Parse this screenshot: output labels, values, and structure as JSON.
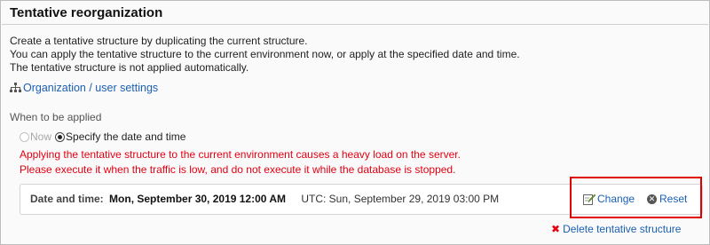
{
  "page": {
    "title": "Tentative reorganization"
  },
  "description": {
    "line1": "Create a tentative structure by duplicating the current structure.",
    "line2": "You can apply the tentative structure to the current environment now, or apply at the specified date and time.",
    "line3": "The tentative structure is not applied automatically."
  },
  "org_link": {
    "label": "Organization / user settings",
    "icon": "org-chart-icon"
  },
  "apply_section": {
    "label": "When to be applied",
    "options": [
      {
        "label": "Now",
        "selected": false,
        "enabled": false
      },
      {
        "label": "Specify the date and time",
        "selected": true,
        "enabled": true
      }
    ]
  },
  "warning": {
    "line1": "Applying the tentative structure to the current environment causes a heavy load on the server.",
    "line2": "Please execute it when the traffic is low, and do not execute it while the database is stopped.",
    "color": "#e60012"
  },
  "schedule": {
    "label": "Date and time:",
    "value": "Mon, September 30, 2019 12:00 AM",
    "utc": "UTC: Sun, September 29, 2019 03:00 PM"
  },
  "actions": {
    "change_label": "Change",
    "change_icon": "pencil-icon",
    "reset_label": "Reset",
    "reset_icon": "reset-icon"
  },
  "delete": {
    "label": "Delete tentative structure",
    "icon": "delete-x-icon"
  },
  "colors": {
    "link": "#1a5fb4",
    "warning": "#e60012",
    "highlight": "#e00000"
  }
}
